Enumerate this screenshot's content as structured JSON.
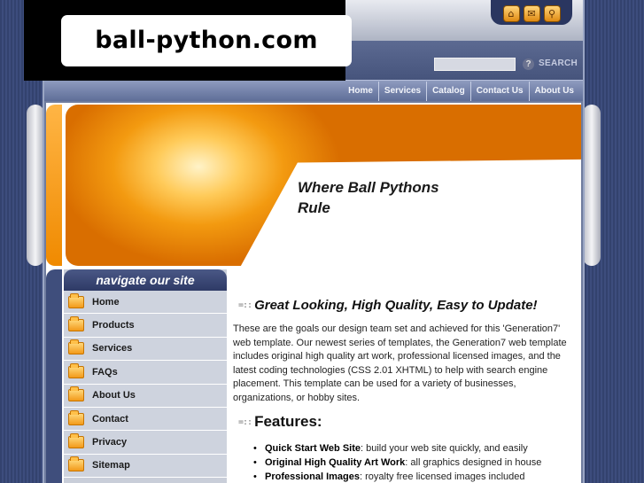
{
  "watermark": {
    "text": "ball-python.com"
  },
  "top_icons": [
    {
      "name": "home-icon",
      "glyph": "⌂"
    },
    {
      "name": "mail-icon",
      "glyph": "✉"
    },
    {
      "name": "search-zoom-icon",
      "glyph": "⚲"
    }
  ],
  "search": {
    "label": "SEARCH",
    "value": "",
    "help_glyph": "?"
  },
  "top_nav": [
    {
      "label": "Home"
    },
    {
      "label": "Services"
    },
    {
      "label": "Catalog"
    },
    {
      "label": "Contact Us"
    },
    {
      "label": "About Us"
    }
  ],
  "hero": {
    "title": "Where Ball Pythons Rule"
  },
  "sidebar": {
    "header": "navigate our site",
    "items": [
      {
        "label": "Home"
      },
      {
        "label": "Products"
      },
      {
        "label": "Services"
      },
      {
        "label": "FAQs"
      },
      {
        "label": "About Us"
      },
      {
        "label": "Contact"
      },
      {
        "label": "Privacy"
      },
      {
        "label": "Sitemap"
      }
    ]
  },
  "main": {
    "heading_lines": "=::",
    "heading": "Great Looking, High Quality, Easy to Update!",
    "paragraph": "These are the goals our design team set and achieved for this 'Generation7' web template. Our newest series of templates, the Generation7 web template includes original high quality art work, professional licensed images, and the latest coding technologies (CSS 2.01 XHTML) to help with search engine placement. This template can be used for a variety of businesses, organizations, or hobby sites.",
    "features_heading": "Features:",
    "features": [
      {
        "bold": "Quick Start Web Site",
        "text": ": build your web site quickly, and easily"
      },
      {
        "bold": "Original High Quality Art Work",
        "text": ": all graphics designed in house"
      },
      {
        "bold": "Professional Images",
        "text": ": royalty free licensed images included"
      }
    ]
  },
  "colors": {
    "page_bg": "#3a4a78",
    "accent_orange": "#f39a10",
    "nav_bar": "#6f7c9e",
    "sidebar_header": "#2e3a66"
  }
}
